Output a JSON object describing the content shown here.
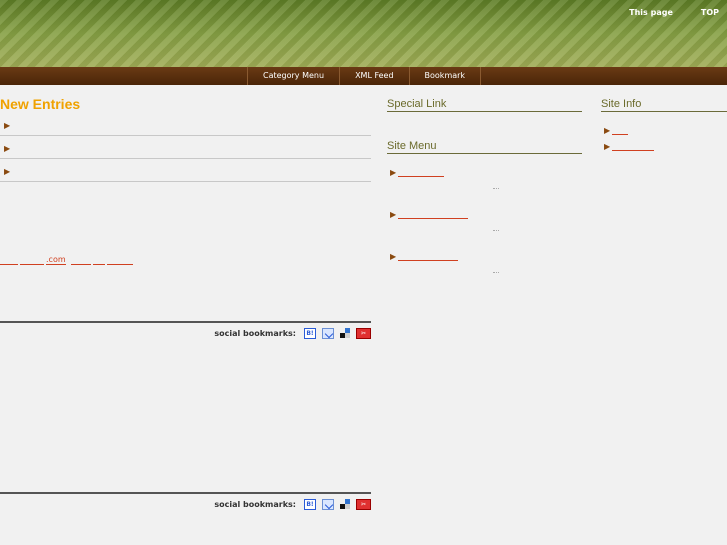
{
  "header": {
    "links": [
      "This page",
      "TOP"
    ]
  },
  "nav": {
    "items": [
      "Category Menu",
      "XML Feed",
      "Bookmark"
    ]
  },
  "main": {
    "new_entries_title": "New Entries",
    "link_com_text": ".com",
    "social_label": "social bookmarks:",
    "social_icons": [
      "hatena-bookmark-icon",
      "clip-icon",
      "delicious-icon",
      "livedoor-clip-icon"
    ]
  },
  "sidebar_mid": {
    "special_link_title": "Special Link",
    "site_menu_title": "Site Menu"
  },
  "sidebar_right": {
    "site_info_title": "Site Info"
  },
  "colors": {
    "accent_orange": "#f0a200",
    "link_red": "#d04020",
    "nav_brown": "#5a2e0e",
    "header_green": "#7f9a3c"
  }
}
